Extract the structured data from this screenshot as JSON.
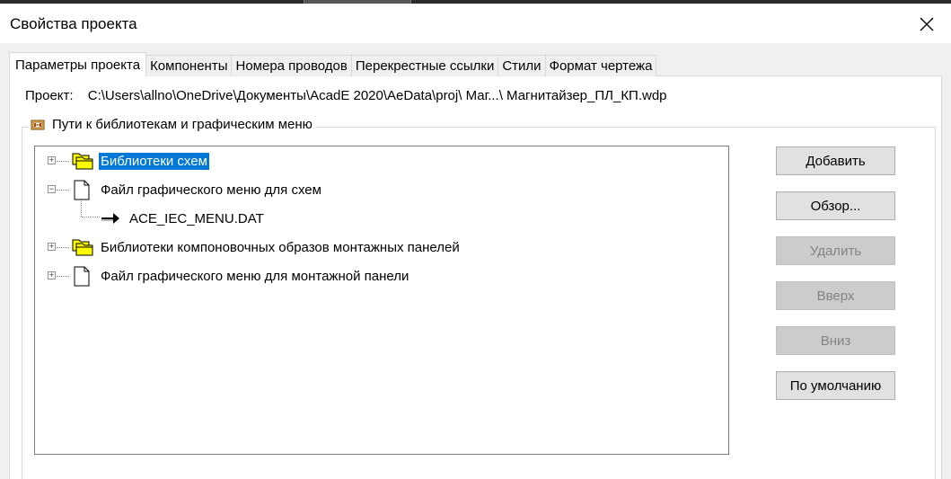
{
  "window": {
    "title": "Свойства проекта",
    "close_icon": "close-icon"
  },
  "tabs": [
    {
      "label": "Параметры проекта",
      "active": true
    },
    {
      "label": "Компоненты",
      "active": false
    },
    {
      "label": "Номера проводов",
      "active": false
    },
    {
      "label": "Перекрестные ссылки",
      "active": false
    },
    {
      "label": "Стили",
      "active": false
    },
    {
      "label": "Формат чертежа",
      "active": false
    }
  ],
  "project": {
    "label": "Проект:",
    "path": "C:\\Users\\allno\\OneDrive\\Документы\\AcadE 2020\\AeData\\proj\\ Маг...\\ Магнитайзер_ПЛ_КП.wdp"
  },
  "library_group": {
    "caption": "Пути к библиотекам и графическим меню",
    "icon": "library-paths-icon"
  },
  "tree": {
    "items": [
      {
        "label": "Библиотеки схем",
        "icon": "folders-icon",
        "expander": "+",
        "selected": true
      },
      {
        "label": "Файл графического меню для схем",
        "icon": "document-icon",
        "expander": "−",
        "selected": false
      },
      {
        "label": "ACE_IEC_MENU.DAT",
        "icon": "arrow-right-icon",
        "expander": "",
        "selected": false
      },
      {
        "label": "Библиотеки компоновочных образов монтажных панелей",
        "icon": "folders-icon",
        "expander": "+",
        "selected": false
      },
      {
        "label": "Файл графического меню для монтажной панели",
        "icon": "document-icon",
        "expander": "+",
        "selected": false
      }
    ]
  },
  "buttons": {
    "add": {
      "label": "Добавить",
      "enabled": true
    },
    "browse": {
      "label": "Обзор...",
      "enabled": true
    },
    "delete": {
      "label": "Удалить",
      "enabled": false
    },
    "up": {
      "label": "Вверх",
      "enabled": false
    },
    "down": {
      "label": "Вниз",
      "enabled": false
    },
    "default": {
      "label": "По умолчанию",
      "enabled": true
    }
  },
  "colors": {
    "selection": "#0078d7",
    "folder_yellow": "#ffff00"
  }
}
